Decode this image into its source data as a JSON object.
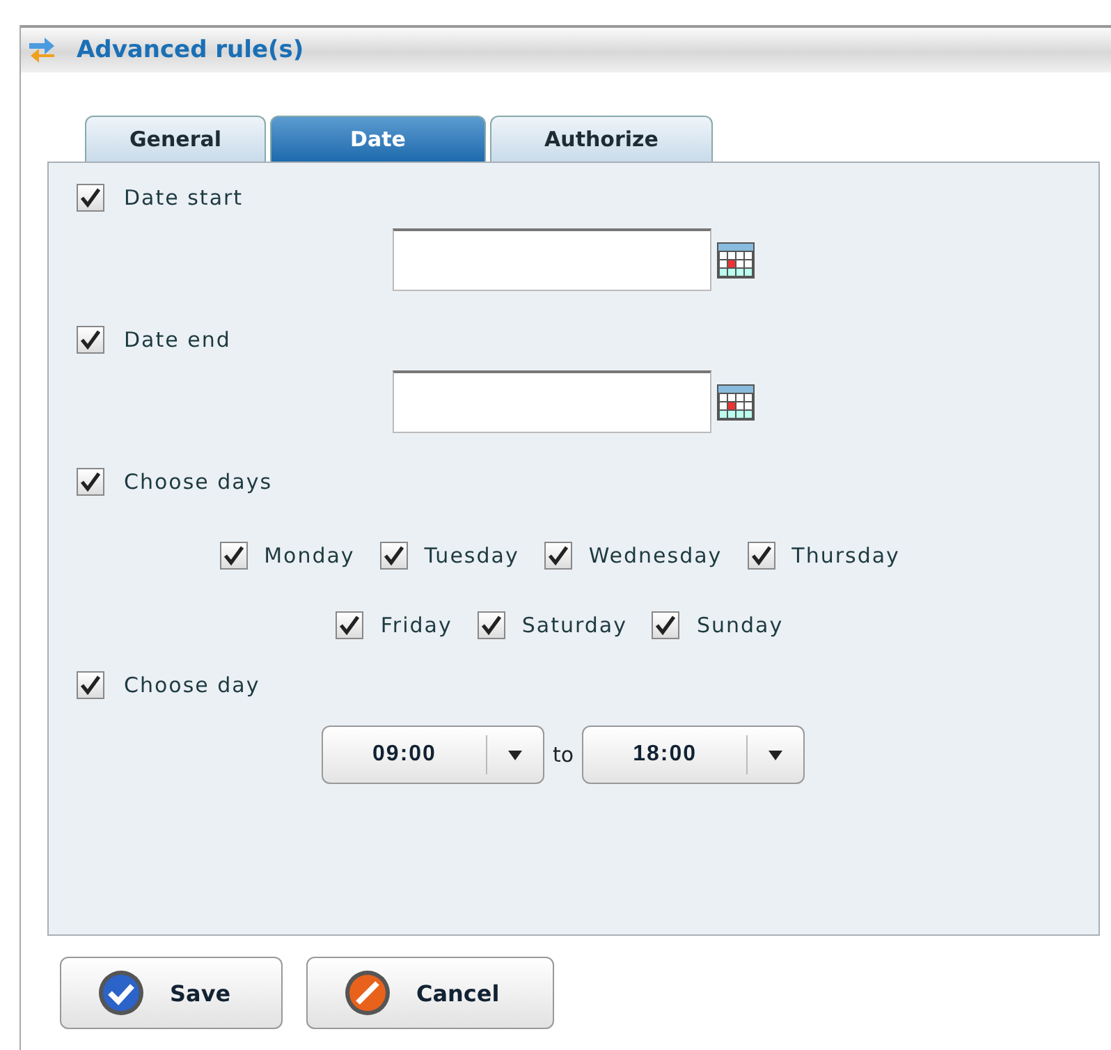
{
  "window": {
    "title": "Advanced rule(s)"
  },
  "tabs": [
    {
      "label": "General",
      "selected": false
    },
    {
      "label": "Date",
      "selected": true
    },
    {
      "label": "Authorize",
      "selected": false
    }
  ],
  "sections": [
    {
      "kind": "date",
      "label": "Date start",
      "checked": true
    },
    {
      "kind": "date",
      "label": "Date end",
      "checked": true
    },
    {
      "kind": "days",
      "label": "Choose days",
      "checked": true,
      "days": [
        [
          {
            "label": "Monday",
            "checked": true
          },
          {
            "label": "Tuesday",
            "checked": true
          },
          {
            "label": "Wednesday",
            "checked": true
          },
          {
            "label": "Thursday",
            "checked": true
          }
        ],
        [
          {
            "label": "Friday",
            "checked": true
          },
          {
            "label": "Saturday",
            "checked": true
          },
          {
            "label": "Sunday",
            "checked": true
          }
        ]
      ]
    },
    {
      "kind": "time",
      "label": "Choose day",
      "checked": true,
      "from": "09:00",
      "separator": "to",
      "until": "18:00"
    }
  ],
  "buttons": [
    {
      "kind": "save",
      "label": "Save"
    },
    {
      "kind": "cancel",
      "label": "Cancel"
    }
  ]
}
